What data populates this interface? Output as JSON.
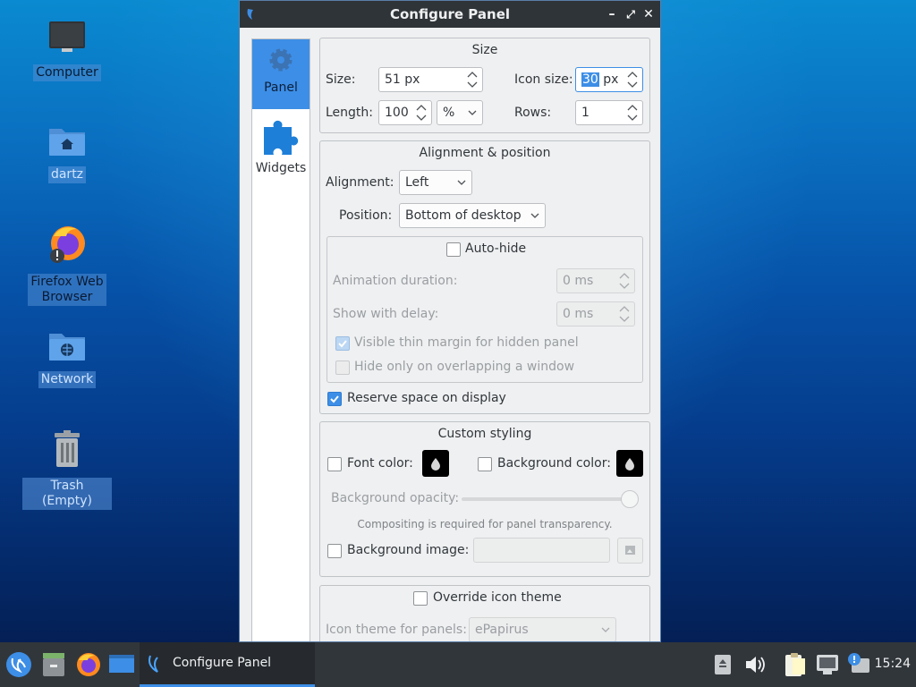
{
  "desktop": {
    "icons": [
      {
        "label": "Computer"
      },
      {
        "label": "dartz"
      },
      {
        "label": "Firefox Web\nBrowser",
        "line1": "Firefox Web",
        "line2": "Browser"
      },
      {
        "label": "Network"
      },
      {
        "label": "Trash (Empty)"
      }
    ]
  },
  "dialog": {
    "title": "Configure Panel",
    "sidebar": [
      {
        "label": "Panel",
        "icon": "gear-icon",
        "active": true
      },
      {
        "label": "Widgets",
        "icon": "puzzle-icon",
        "active": false
      }
    ],
    "size_group": {
      "title": "Size",
      "size_label": "Size:",
      "size_value": "51 px",
      "icon_size_label": "Icon size:",
      "icon_size_number": "30",
      "icon_size_unit": " px",
      "length_label": "Length:",
      "length_value": "100",
      "length_unit": "%",
      "rows_label": "Rows:",
      "rows_value": "1"
    },
    "alignment_group": {
      "title": "Alignment & position",
      "alignment_label": "Alignment:",
      "alignment_value": "Left",
      "position_label": "Position:",
      "position_value": "Bottom of desktop",
      "autohide_label": "Auto-hide",
      "autohide_checked": false,
      "animation_label": "Animation duration:",
      "animation_value": "0 ms",
      "delay_label": "Show with delay:",
      "delay_value": "0 ms",
      "thin_margin_label": "Visible thin margin for hidden panel",
      "thin_margin_checked": true,
      "overlap_label": "Hide only on overlapping a window",
      "overlap_checked": false,
      "reserve_label": "Reserve space on display",
      "reserve_checked": true
    },
    "styling_group": {
      "title": "Custom styling",
      "font_color_label": "Font color:",
      "bg_color_label": "Background color:",
      "opacity_label": "Background opacity:",
      "opacity_value": 1.0,
      "compositing_note": "Compositing is required for panel transparency.",
      "bg_image_label": "Background image:",
      "bg_image_value": ""
    },
    "icon_theme_group": {
      "override_label": "Override icon theme",
      "theme_label": "Icon theme for panels:",
      "theme_value": "ePapirus"
    }
  },
  "taskbar": {
    "active_task_label": "Configure Panel",
    "clock": "15:24"
  },
  "colors": {
    "accent": "#3d8ee6",
    "titlebar": "#2f3438",
    "taskbar": "#31363b",
    "dialog_bg": "#eff0f1"
  }
}
